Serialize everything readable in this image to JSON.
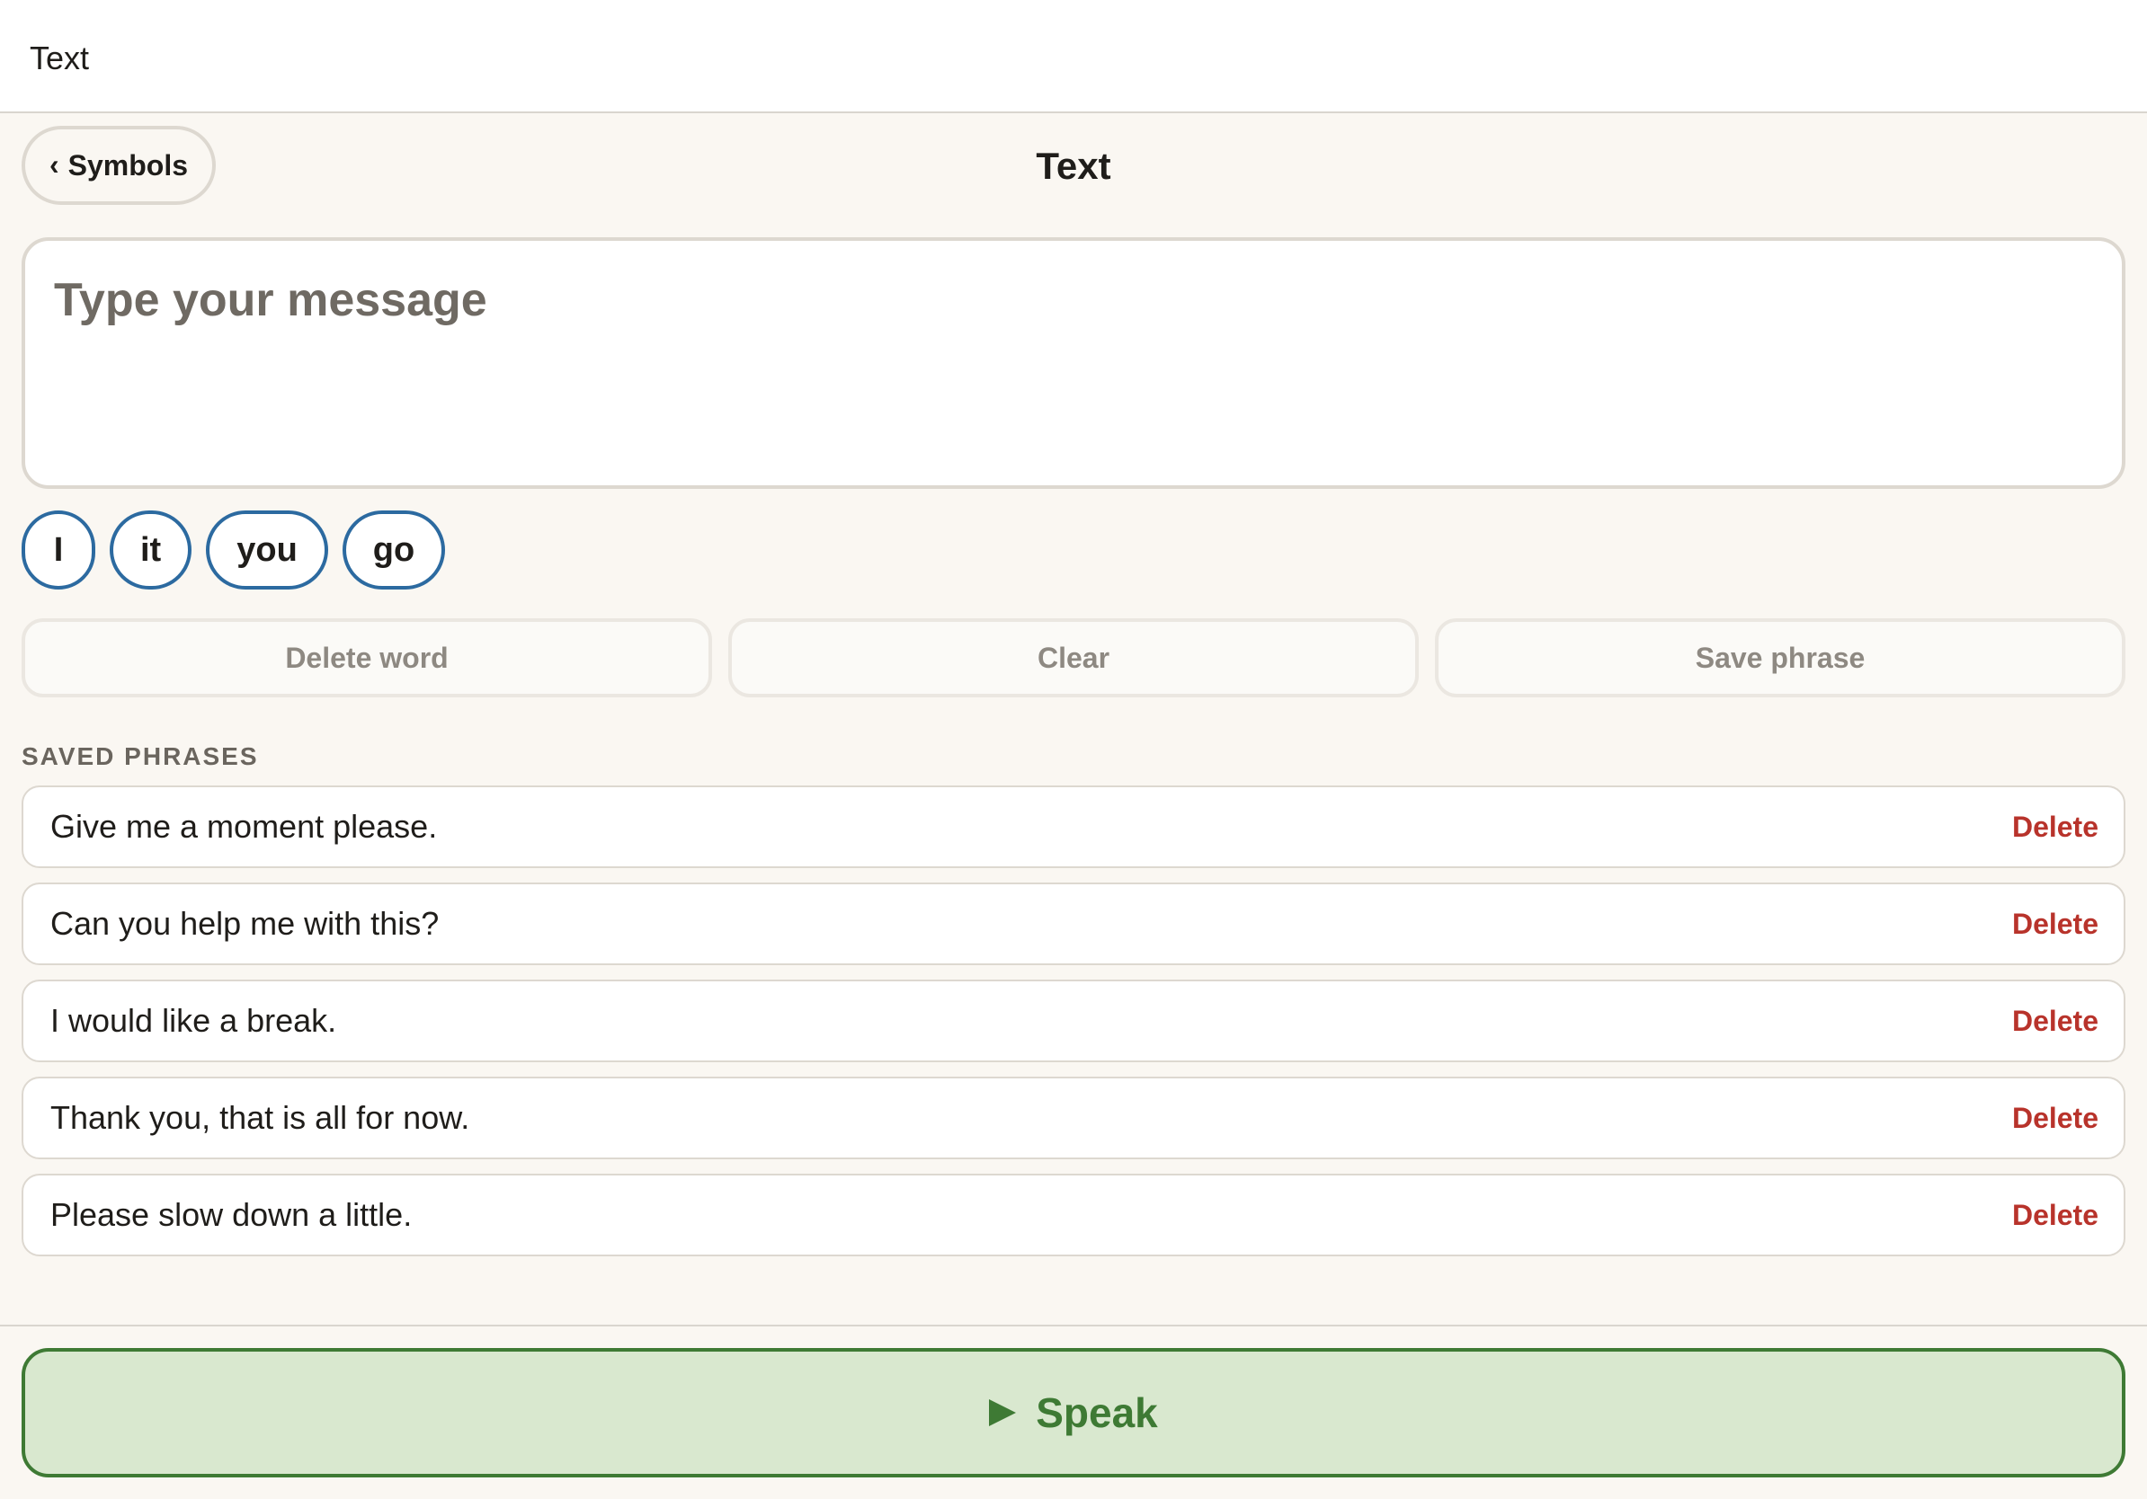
{
  "topbar": {
    "title": "Text"
  },
  "header": {
    "back_label": "Symbols",
    "title": "Text"
  },
  "message": {
    "value": "",
    "placeholder": "Type your message"
  },
  "suggestions": [
    "I",
    "it",
    "you",
    "go"
  ],
  "actions": {
    "delete_word": "Delete word",
    "clear": "Clear",
    "save_phrase": "Save phrase"
  },
  "saved_phrases": {
    "label": "SAVED PHRASES",
    "delete_label": "Delete",
    "items": [
      {
        "text": "Give me a moment please."
      },
      {
        "text": "Can you help me with this?"
      },
      {
        "text": "I would like a break."
      },
      {
        "text": "Thank you, that is all for now."
      },
      {
        "text": "Please slow down a little."
      }
    ]
  },
  "speak": {
    "label": "Speak"
  },
  "icons": {
    "back": "chevron-left-icon",
    "speak": "play-icon"
  },
  "colors": {
    "background": "#faf7f2",
    "chip_border": "#2c6aa0",
    "delete": "#b8332b",
    "speak_bg": "#d9e8cf",
    "speak_fg": "#3e7a34"
  }
}
